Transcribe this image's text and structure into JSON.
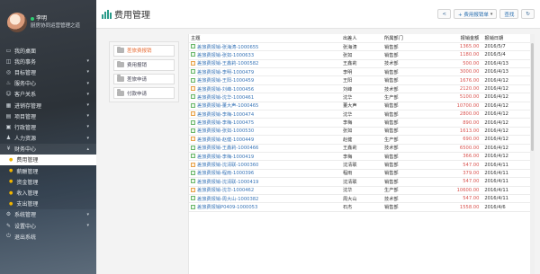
{
  "profile": {
    "name": "李明",
    "subtitle": "厨房协同运营管理之道"
  },
  "nav": [
    {
      "label": "我的桌面",
      "icon": "desktop-icon",
      "chev": false
    },
    {
      "label": "我的事务",
      "icon": "tasks-icon",
      "chev": true
    },
    {
      "label": "目标管理",
      "icon": "target-icon",
      "chev": true
    },
    {
      "label": "服务中心",
      "icon": "service-icon",
      "chev": true
    },
    {
      "label": "客户关系",
      "icon": "customer-icon",
      "chev": true
    },
    {
      "label": "进销存管理",
      "icon": "inventory-icon",
      "chev": true
    },
    {
      "label": "项目管理",
      "icon": "project-icon",
      "chev": true
    },
    {
      "label": "行政管理",
      "icon": "admin-icon",
      "chev": true
    },
    {
      "label": "人力资源",
      "icon": "hr-icon",
      "chev": true
    },
    {
      "label": "财务中心",
      "icon": "finance-icon",
      "chev": true
    }
  ],
  "subnav": [
    {
      "label": "费用管理"
    },
    {
      "label": "薪酬管理"
    },
    {
      "label": "资金管理"
    },
    {
      "label": "收入管理"
    },
    {
      "label": "支出管理"
    }
  ],
  "nav_bottom": [
    {
      "label": "系统管理",
      "icon": "system-icon",
      "chev": true
    },
    {
      "label": "设置中心",
      "icon": "settings-icon",
      "chev": true
    },
    {
      "label": "退出系统",
      "icon": "logout-icon",
      "chev": false
    }
  ],
  "page": {
    "title": "费用管理"
  },
  "toolbar": {
    "back": "<",
    "report": "+ 费用报销单",
    "report_caret": "▾",
    "search": "查找",
    "refresh": "↻"
  },
  "leftpanel": [
    {
      "label": "差旅费报销",
      "active": true
    },
    {
      "label": "费用报销",
      "active": false
    },
    {
      "label": "差旅申请",
      "active": false
    },
    {
      "label": "付款申请",
      "active": false
    }
  ],
  "table": {
    "headers": [
      "主题",
      "出差人",
      "所属部门",
      "报销金额",
      "报销日期"
    ],
    "rows": [
      [
        "差旅费报销-张海涛-1000655",
        "张海涛",
        "销售部",
        "1365.00",
        "2016/5/7"
      ],
      [
        "差旅费报销-张如-1000633",
        "张如",
        "销售部",
        "1180.00",
        "2016/5/4"
      ],
      [
        "差旅费报销-王鑫莉-1000582",
        "王鑫莉",
        "技术部",
        "500.00",
        "2016/4/13"
      ],
      [
        "差旅费报销-李明-1000479",
        "李明",
        "销售部",
        "3000.00",
        "2016/4/13"
      ],
      [
        "差旅费报销-王阳-1000459",
        "王阳",
        "销售部",
        "1676.00",
        "2016/4/12"
      ],
      [
        "差旅费报销-刘峰-1000456",
        "刘峰",
        "技术部",
        "2120.00",
        "2016/4/12"
      ],
      [
        "差旅费报销-沈华-1000461",
        "沈华",
        "生产部",
        "5100.00",
        "2016/4/12"
      ],
      [
        "差旅费报销-董大声-1000465",
        "董大声",
        "销售部",
        "10700.00",
        "2016/4/12"
      ],
      [
        "差旅费报销-李梅-1000474",
        "沈华",
        "销售部",
        "2800.00",
        "2016/4/12"
      ],
      [
        "差旅费报销-李梅-1000475",
        "李梅",
        "销售部",
        "890.00",
        "2016/4/12"
      ],
      [
        "差旅费报销-张如-1000530",
        "张如",
        "销售部",
        "1613.00",
        "2016/4/12"
      ],
      [
        "差旅费报销-赵健-1000449",
        "赵健",
        "生产部",
        "690.00",
        "2016/4/12"
      ],
      [
        "差旅费报销-王鑫莉-1000466",
        "王鑫莉",
        "技术部",
        "6500.00",
        "2016/4/12"
      ],
      [
        "差旅费报销-李梅-1000419",
        "李梅",
        "销售部",
        "366.00",
        "2016/4/12"
      ],
      [
        "差旅费报销-沈清联-1000360",
        "沈清联",
        "销售部",
        "547.00",
        "2016/4/11"
      ],
      [
        "差旅费报销-程雨-1000396",
        "程雨",
        "销售部",
        "379.00",
        "2016/4/11"
      ],
      [
        "差旅费报销-沈清联-1000419",
        "沈清联",
        "销售部",
        "547.00",
        "2016/4/11"
      ],
      [
        "差旅费报销-沈华-1000462",
        "沈华",
        "生产部",
        "10600.00",
        "2016/4/11"
      ],
      [
        "差旅费报销-周大山-1000382",
        "周大山",
        "技术部",
        "547.00",
        "2016/4/11"
      ],
      [
        "差旅费报销P0409-1000053",
        "石杰",
        "销售部",
        "1558.00",
        "2016/4/6"
      ]
    ]
  }
}
